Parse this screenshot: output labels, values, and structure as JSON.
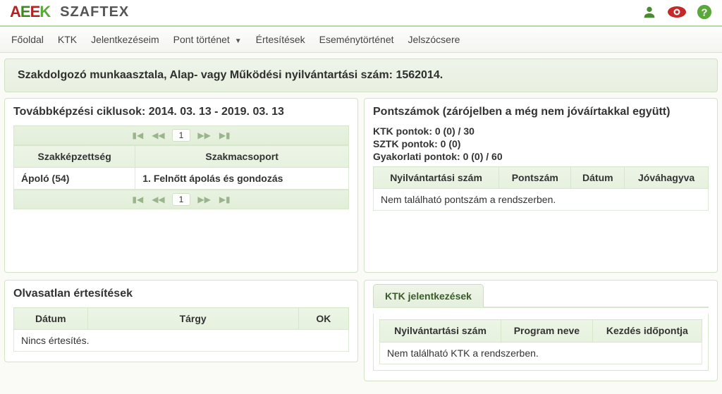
{
  "header": {
    "site_name": "SZAFTEX"
  },
  "nav": {
    "items": [
      "Főoldal",
      "KTK",
      "Jelentkezéseim",
      "Pont történet",
      "Értesítések",
      "Eseménytörténet",
      "Jelszócsere"
    ],
    "dropdown_index": 3
  },
  "page_title": "Szakdolgozó munkaasztala, Alap- vagy Működési nyilvántartási szám: 1562014.",
  "cycles": {
    "title": "Továbbképzési ciklusok: 2014. 03. 13 - 2019. 03. 13",
    "pager_page": "1",
    "columns": [
      "Szakképzettség",
      "Szakmacsoport"
    ],
    "rows": [
      {
        "qual": "Ápoló (54)",
        "group": "1. Felnőtt ápolás és gondozás"
      }
    ]
  },
  "points_panel": {
    "title": "Pontszámok (zárójelben a még nem jóváírtakkal együtt)",
    "lines": [
      {
        "label": "KTK pontok:",
        "value": "0 (0) / 30"
      },
      {
        "label": "SZTK pontok:",
        "value": "0 (0)"
      },
      {
        "label": "Gyakorlati pontok:",
        "value": "0 (0) / 60"
      }
    ],
    "columns": [
      "Nyilvántartási szám",
      "Pontszám",
      "Dátum",
      "Jóváhagyva"
    ],
    "empty_message": "Nem található pontszám a rendszerben."
  },
  "unread_panel": {
    "title": "Olvasatlan értesítések",
    "columns": [
      "Dátum",
      "Tárgy",
      "OK"
    ],
    "empty_message": "Nincs értesítés."
  },
  "applications": {
    "tab_label": "KTK jelentkezések",
    "columns": [
      "Nyilvántartási szám",
      "Program neve",
      "Kezdés időpontja"
    ],
    "empty_message": "Nem található KTK a rendszerben."
  }
}
